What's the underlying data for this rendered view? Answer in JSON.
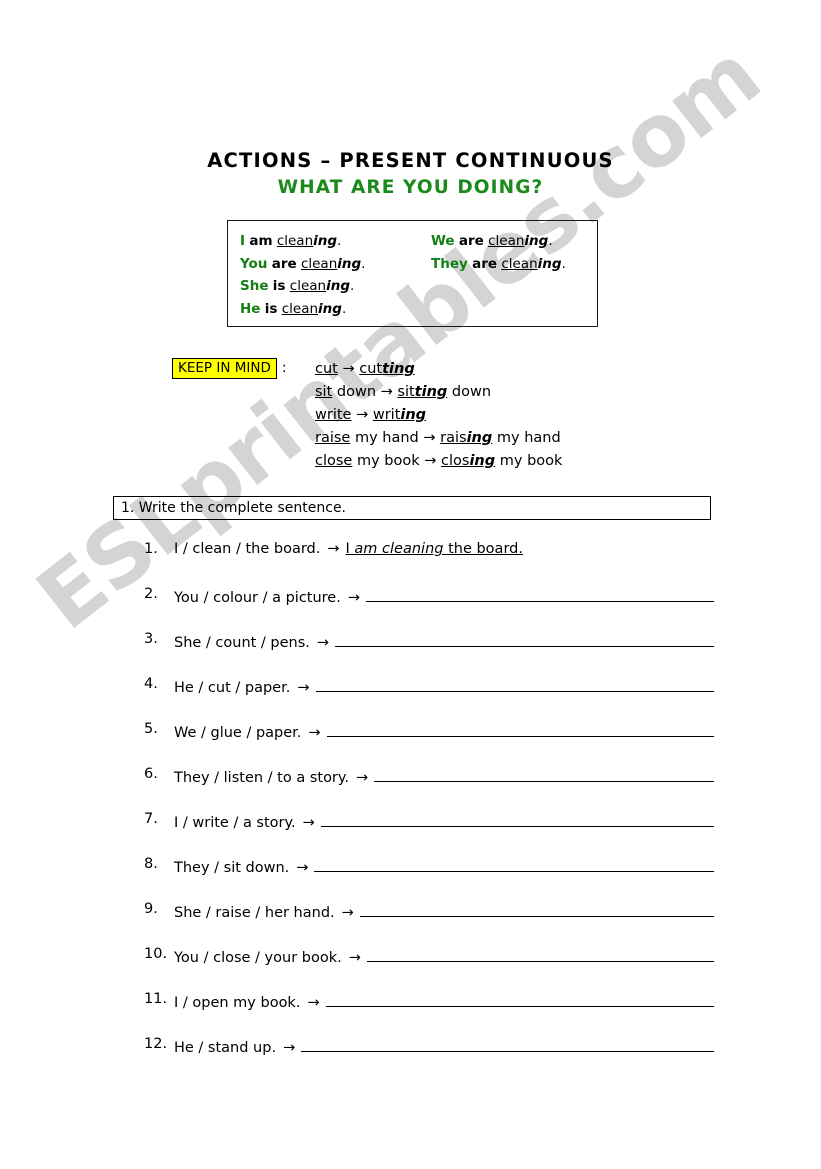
{
  "header": {
    "main_title": "ACTIONS – PRESENT CONTINUOUS",
    "sub_title": "WHAT ARE YOU DOING?",
    "title_color": "#000000",
    "subtitle_color": "#1b8a1b"
  },
  "conjugation_box": {
    "pronoun_color": "#128012",
    "left_column": [
      {
        "pronoun": "I",
        "aux": "am",
        "stem": "clean",
        "ending": "ing",
        "period": "."
      },
      {
        "pronoun": "You",
        "aux": "are",
        "stem": "clean",
        "ending": "ing",
        "period": "."
      },
      {
        "pronoun": "She",
        "aux": "is",
        "stem": "clean",
        "ending": "ing",
        "period": "."
      },
      {
        "pronoun": "He",
        "aux": "is",
        "stem": "clean",
        "ending": "ing",
        "period": "."
      }
    ],
    "right_column": [
      {
        "pronoun": "We",
        "aux": "are",
        "stem": "clean",
        "ending": "ing",
        "period": "."
      },
      {
        "pronoun": "They",
        "aux": "are",
        "stem": "clean",
        "ending": "ing",
        "period": "."
      }
    ]
  },
  "keep_in_mind": {
    "badge_label": "KEEP IN MIND",
    "badge_bg": "#ffff00",
    "colon": ":",
    "examples": [
      {
        "base_stem": "cut",
        "base_tail": "",
        "result_stem": "cut",
        "result_ending": "ting",
        "result_tail": ""
      },
      {
        "base_stem": "sit",
        "base_tail": " down",
        "result_stem": "sit",
        "result_ending": "ting",
        "result_tail": " down"
      },
      {
        "base_stem": "write",
        "base_tail": "",
        "result_stem": "writ",
        "result_ending": "ing",
        "result_tail": ""
      },
      {
        "base_stem": "raise",
        "base_tail": " my hand",
        "result_stem": "rais",
        "result_ending": "ing",
        "result_tail": " my hand"
      },
      {
        "base_stem": "close",
        "base_tail": " my book",
        "result_stem": "clos",
        "result_ending": "ing",
        "result_tail": " my book"
      }
    ],
    "arrow": "→"
  },
  "instruction": {
    "text": "1. Write the complete sentence."
  },
  "exercise": {
    "arrow": "→",
    "items": [
      {
        "number": "1.",
        "prompt": "I / clean / the board.",
        "answered": true,
        "answer_pre": "I ",
        "answer_italic": "am cleaning",
        "answer_post": " the board."
      },
      {
        "number": "2.",
        "prompt": "You / colour / a picture.",
        "answered": false
      },
      {
        "number": "3.",
        "prompt": "She / count / pens.",
        "answered": false
      },
      {
        "number": "4.",
        "prompt": "He / cut / paper.",
        "answered": false
      },
      {
        "number": "5.",
        "prompt": "We / glue / paper.",
        "answered": false
      },
      {
        "number": "6.",
        "prompt": "They / listen / to a story.",
        "answered": false
      },
      {
        "number": "7.",
        "prompt": "I / write / a story.",
        "answered": false
      },
      {
        "number": "8.",
        "prompt": "They / sit down.",
        "answered": false
      },
      {
        "number": "9.",
        "prompt": "She / raise / her hand.",
        "answered": false
      },
      {
        "number": "10.",
        "prompt": "You / close / your book.",
        "answered": false
      },
      {
        "number": "11.",
        "prompt": "I / open my book.",
        "answered": false
      },
      {
        "number": "12.",
        "prompt": "He / stand up.",
        "answered": false
      }
    ]
  },
  "watermark": {
    "text": "ESLprintables.com",
    "color": "#c9c9c9"
  }
}
